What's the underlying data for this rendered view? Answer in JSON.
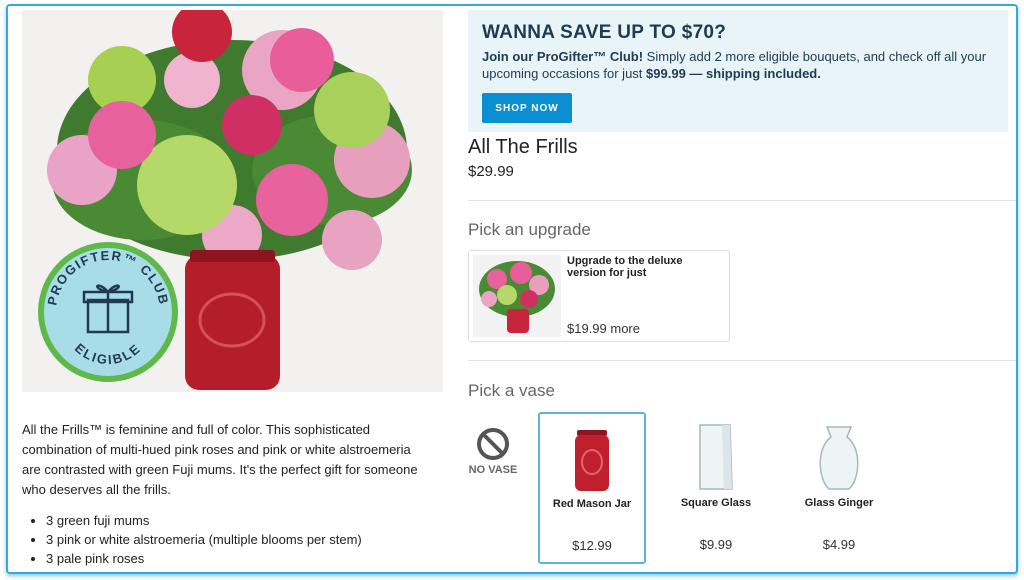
{
  "promo": {
    "title": "WANNA SAVE UP TO $70?",
    "text_lead": "Join our ProGifter™ Club!",
    "text_body": " Simply add 2 more eligible bouquets, and check off all your upcoming occasions for just ",
    "text_price": "$99.99 — shipping included.",
    "button": "SHOP NOW"
  },
  "product": {
    "name": "All The Frills",
    "price": "$29.99",
    "badge_top": "PROGIFTER™ CLUB",
    "badge_bottom": "ELIGIBLE",
    "description": "All the Frills™ is feminine and full of color. This sophisticated combination of multi-hued pink roses and pink or white alstroemeria are contrasted with green Fuji mums. It's the perfect gift for someone who deserves all the frills.",
    "features": [
      "3 green fuji mums",
      "3 pink or white alstroemeria (multiple blooms per stem)",
      "3 pale pink roses"
    ]
  },
  "upgrade": {
    "section_title": "Pick an upgrade",
    "text": "Upgrade to the deluxe version for just",
    "price": "$19.99 more"
  },
  "vase": {
    "section_title": "Pick a vase",
    "none_label": "NO VASE",
    "options": [
      {
        "name": "Red Mason Jar",
        "price": "$12.99",
        "selected": true
      },
      {
        "name": "Square Glass",
        "price": "$9.99",
        "selected": false
      },
      {
        "name": "Glass Ginger",
        "price": "$4.99",
        "selected": false
      }
    ]
  },
  "colors": {
    "accent": "#0a8fd1",
    "promo_bg": "#e8f4f7",
    "frame_border": "#37a8dc",
    "badge_bg": "#a8dde8",
    "badge_ring": "#5fb94a"
  }
}
